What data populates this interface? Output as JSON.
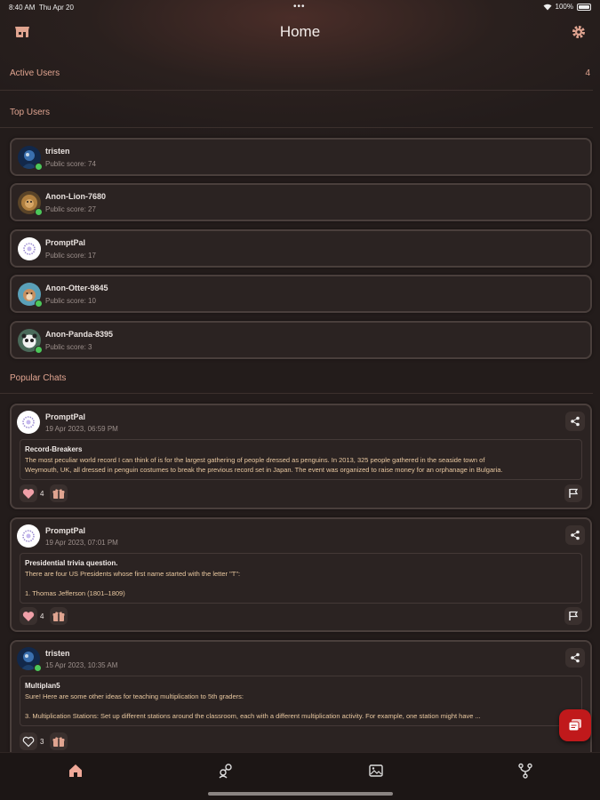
{
  "status_bar": {
    "time": "8:40 AM",
    "date": "Thu Apr 20",
    "dots": "•••",
    "battery": "100%"
  },
  "header": {
    "title": "Home",
    "left_icon": "store-icon",
    "right_icon": "gear-icon"
  },
  "active_users": {
    "label": "Active Users",
    "count": "4"
  },
  "top_users": {
    "label": "Top Users",
    "items": [
      {
        "name": "tristen",
        "score": "Public score: 74",
        "avatar_color": "#1e4a7a",
        "online": true
      },
      {
        "name": "Anon-Lion-7680",
        "score": "Public score: 27",
        "avatar_color": "#8a6a3a",
        "online": true
      },
      {
        "name": "PromptPal",
        "score": "Public score: 17",
        "avatar_color": "#ffffff",
        "online": false
      },
      {
        "name": "Anon-Otter-9845",
        "score": "Public score: 10",
        "avatar_color": "#5aa0b8",
        "online": true
      },
      {
        "name": "Anon-Panda-8395",
        "score": "Public score: 3",
        "avatar_color": "#5a7a6a",
        "online": true
      }
    ]
  },
  "popular_chats": {
    "label": "Popular Chats",
    "items": [
      {
        "name": "PromptPal",
        "date": "19 Apr 2023, 06:59 PM",
        "heading": "Record-Breakers",
        "lines": [
          "The most peculiar world record I can think of is for the largest gathering of people dressed as penguins. In 2013, 325 people gathered in the seaside town of",
          "Weymouth, UK, all dressed in penguin costumes to break the previous record set in Japan. The event was organized to raise money for an orphanage in Bulgaria."
        ],
        "likes": "4",
        "avatar_color": "#ffffff",
        "liked": true
      },
      {
        "name": "PromptPal",
        "date": "19 Apr 2023, 07:01 PM",
        "heading": "Presidential trivia question.",
        "lines": [
          "There are four US Presidents whose first name started with the letter \"T\":",
          "",
          "1. Thomas Jefferson (1801–1809)"
        ],
        "likes": "4",
        "avatar_color": "#ffffff",
        "liked": true
      },
      {
        "name": "tristen",
        "date": "15 Apr 2023, 10:35 AM",
        "heading": "Multiplan5",
        "lines": [
          "Sure! Here are some other ideas for teaching multiplication to 5th graders:",
          "",
          "3. Multiplication Stations: Set up different stations around the classroom, each with a different multiplication activity. For example, one station might have ..."
        ],
        "likes": "3",
        "avatar_color": "#1e4a7a",
        "liked": false
      }
    ]
  },
  "bottom_nav": [
    {
      "name": "home",
      "icon": "home-icon",
      "active": true
    },
    {
      "name": "users",
      "icon": "users-icon",
      "active": false
    },
    {
      "name": "gallery",
      "icon": "gallery-icon",
      "active": false
    },
    {
      "name": "branch",
      "icon": "branch-icon",
      "active": false
    }
  ],
  "colors": {
    "accent": "#e0a490",
    "fab": "#c0191b",
    "online": "#4cc85a",
    "background": "#231c1b"
  }
}
